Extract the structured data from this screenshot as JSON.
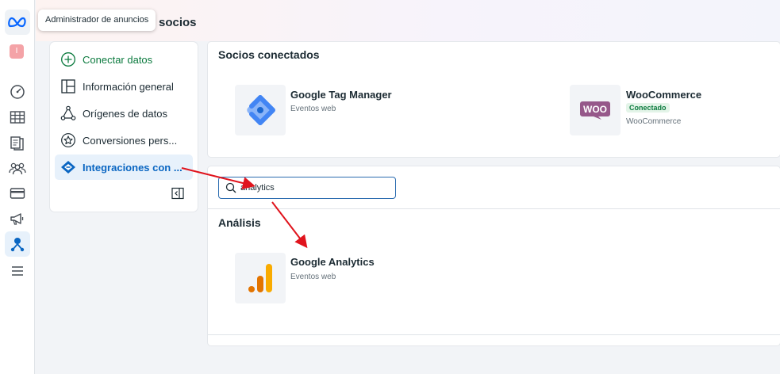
{
  "tooltip": "Administrador de anuncios",
  "header": {
    "title_partial": "socios"
  },
  "rail": {
    "avatar_letter": "I",
    "icons": [
      "meta-logo-icon",
      "dashboard-gauge-icon",
      "table-grid-icon",
      "document-stack-icon",
      "people-group-icon",
      "credit-card-icon",
      "megaphone-icon",
      "partner-integrations-icon",
      "menu-lines-icon"
    ]
  },
  "nav": {
    "items": [
      {
        "label": "Conectar datos",
        "icon": "plus-circle-icon"
      },
      {
        "label": "Información general",
        "icon": "overview-layout-icon"
      },
      {
        "label": "Orígenes de datos",
        "icon": "data-sources-icon"
      },
      {
        "label": "Conversiones pers...",
        "icon": "star-circle-icon"
      },
      {
        "label": "Integraciones con ...",
        "icon": "handshake-icon"
      }
    ],
    "active_index": 4
  },
  "connected": {
    "title": "Socios conectados",
    "partners": [
      {
        "name": "Google Tag Manager",
        "subtitle": "Eventos web",
        "badge": ""
      },
      {
        "name": "WooCommerce",
        "subtitle": "WooCommerce",
        "badge": "Conectado"
      }
    ],
    "woo_logo_text": "WOO"
  },
  "search": {
    "value": "analytics"
  },
  "analysis": {
    "title": "Análisis",
    "partners": [
      {
        "name": "Google Analytics",
        "subtitle": "Eventos web"
      }
    ]
  },
  "colors": {
    "accent_blue": "#0a66c2",
    "connected_green": "#0b7a3e",
    "arrow_red": "#e0141d",
    "gtm_blue": "#4285f4",
    "woo_purple": "#96588a",
    "ga_orange": "#f9ab00"
  }
}
